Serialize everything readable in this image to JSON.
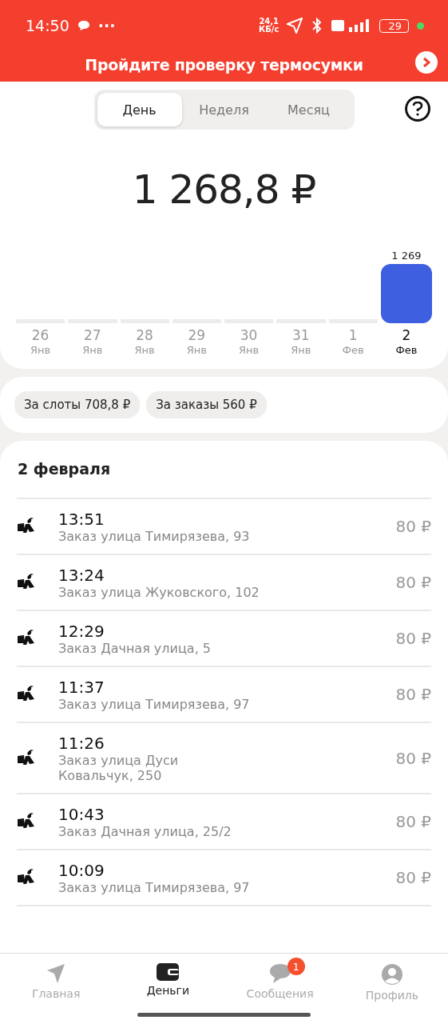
{
  "status_bar": {
    "time": "14:50",
    "more": "···",
    "speed": "24,1\nКБ/с",
    "battery": "29"
  },
  "banner": {
    "text": "Пройдите проверку термосумки"
  },
  "period_tabs": [
    {
      "label": "День",
      "selected": true
    },
    {
      "label": "Неделя",
      "selected": false
    },
    {
      "label": "Месяц",
      "selected": false
    }
  ],
  "total": "1 268,8 ₽",
  "chart": {
    "chart_data": {
      "type": "bar",
      "categories": [
        "26",
        "27",
        "28",
        "29",
        "30",
        "31",
        "1",
        "2"
      ],
      "values": [
        0,
        0,
        0,
        0,
        0,
        0,
        0,
        1269
      ],
      "color": "#3d5fe0",
      "value_labels": [
        null,
        null,
        null,
        null,
        null,
        null,
        null,
        "1 269"
      ]
    },
    "days": [
      {
        "month": "Янв",
        "selected": false
      },
      {
        "month": "Янв",
        "selected": false
      },
      {
        "month": "Янв",
        "selected": false
      },
      {
        "month": "Янв",
        "selected": false
      },
      {
        "month": "Янв",
        "selected": false
      },
      {
        "month": "Янв",
        "selected": false
      },
      {
        "month": "Фев",
        "selected": false
      },
      {
        "month": "Фев",
        "selected": true
      }
    ]
  },
  "chips": [
    "За слоты 708,8 ₽",
    "За заказы 560 ₽"
  ],
  "list": {
    "date": "2 февраля",
    "rows": [
      {
        "time": "13:51",
        "title": "Заказ улица Тимирязева, 93",
        "amount": "80 ₽"
      },
      {
        "time": "13:24",
        "title": "Заказ улица Жуковского, 102",
        "amount": "80 ₽"
      },
      {
        "time": "12:29",
        "title": "Заказ Дачная улица, 5",
        "amount": "80 ₽"
      },
      {
        "time": "11:37",
        "title": "Заказ улица Тимирязева, 97",
        "amount": "80 ₽"
      },
      {
        "time": "11:26",
        "title": "Заказ улица Дуси\nКовальчук, 250",
        "amount": "80 ₽"
      },
      {
        "time": "10:43",
        "title": "Заказ Дачная улица, 25/2",
        "amount": "80 ₽"
      },
      {
        "time": "10:09",
        "title": "Заказ улица Тимирязева, 97",
        "amount": "80 ₽"
      }
    ]
  },
  "nav": [
    {
      "label": "Главная",
      "kind": "arrow",
      "selected": false
    },
    {
      "label": "Деньги",
      "kind": "wallet",
      "selected": true
    },
    {
      "label": "Сообщения",
      "kind": "chat",
      "selected": false,
      "badge": "1"
    },
    {
      "label": "Профиль",
      "kind": "person",
      "selected": false
    }
  ]
}
